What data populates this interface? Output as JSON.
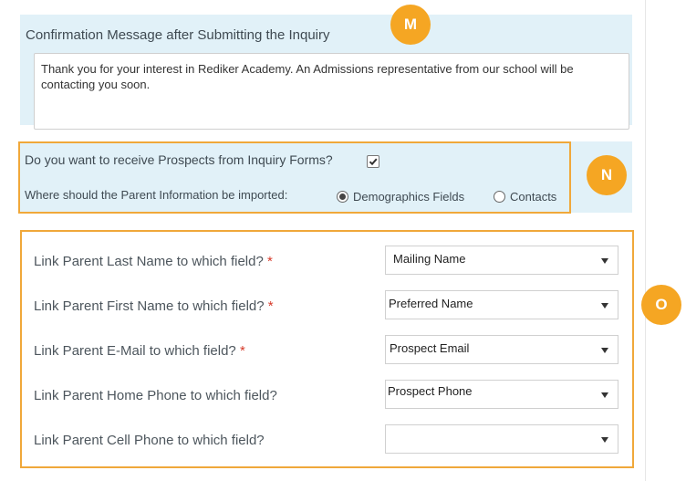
{
  "section_m": {
    "badge": "M",
    "title": "Confirmation Message after Submitting the Inquiry",
    "message": "Thank you for your interest in Rediker Academy. An Admissions representative from our school will be contacting you soon."
  },
  "section_n": {
    "badge": "N",
    "question_prospects": "Do you want to receive Prospects from Inquiry Forms?",
    "prospects_checked": true,
    "question_import": "Where should the Parent Information be imported:",
    "options": [
      "Demographics Fields",
      "Contacts"
    ],
    "selected_option": "Demographics Fields"
  },
  "section_o": {
    "badge": "O",
    "required_marker": "*",
    "rows": [
      {
        "label": "Link Parent Last Name to which field?",
        "value": "Mailing Name"
      },
      {
        "label": "Link Parent First Name to which field?",
        "value": "Preferred Name"
      },
      {
        "label": "Link Parent E-Mail to which field?",
        "value": "Prospect Email"
      },
      {
        "label": "Link Parent Home Phone to which field?",
        "value": "Prospect Phone"
      },
      {
        "label": "Link Parent Cell Phone to which field?",
        "value": ""
      }
    ]
  },
  "colors": {
    "highlight_border": "#f0a83a",
    "badge": "#f5a623",
    "panel_bg": "#e1f1f8",
    "required": "#d63a2a"
  }
}
